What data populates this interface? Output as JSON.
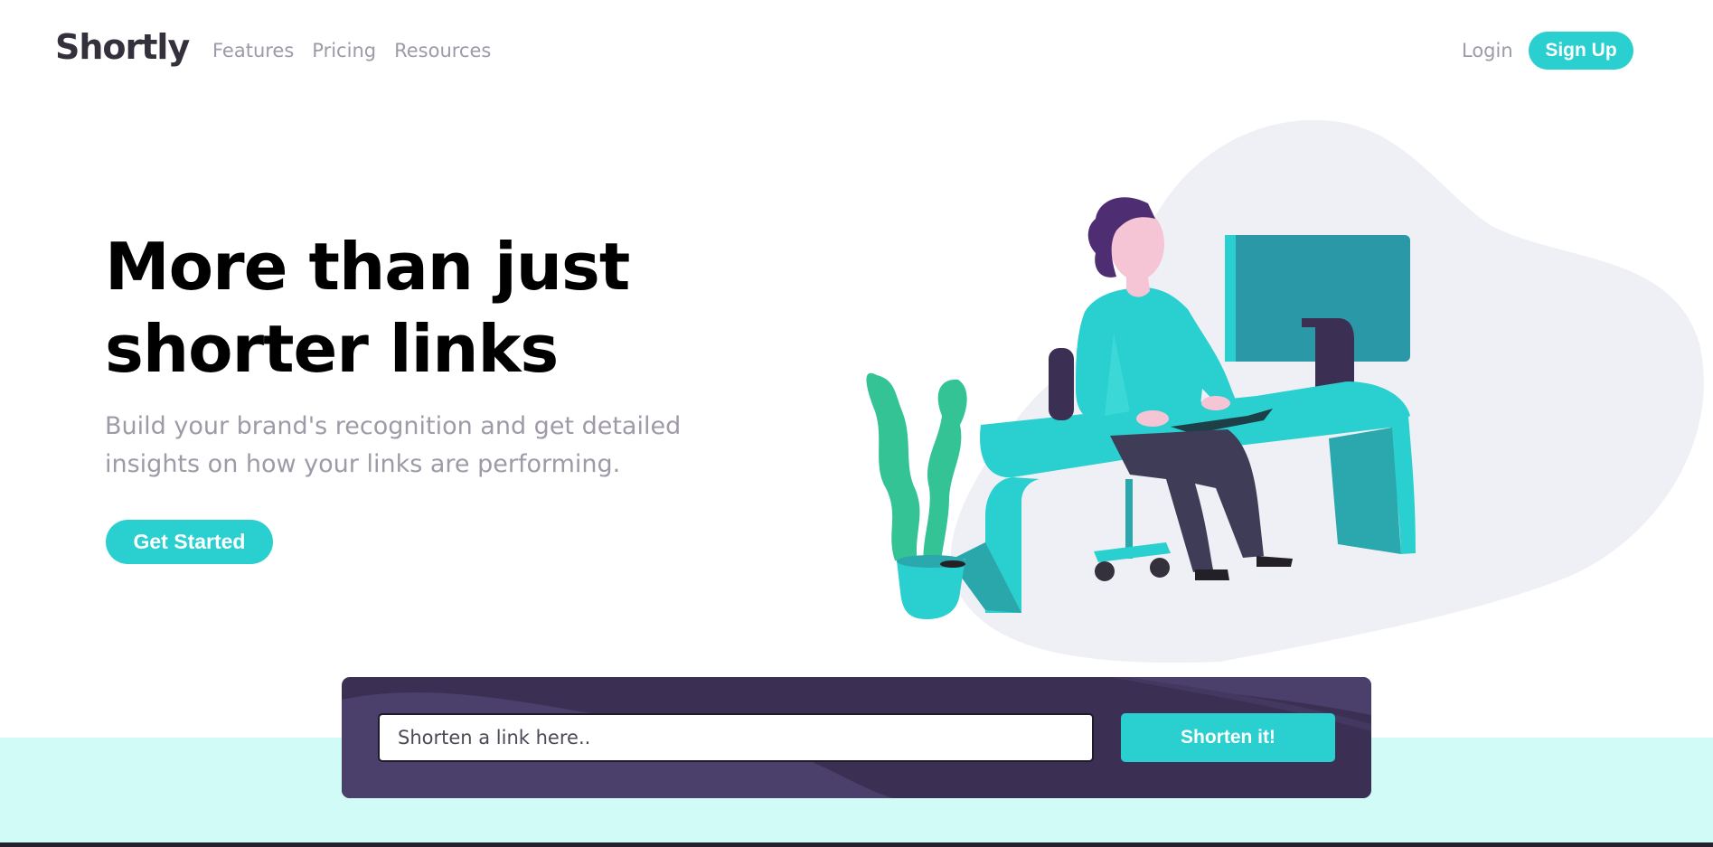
{
  "header": {
    "logo": "Shortly",
    "nav": [
      "Features",
      "Pricing",
      "Resources"
    ],
    "login": "Login",
    "signup": "Sign Up"
  },
  "hero": {
    "title": "More than just shorter links",
    "subtitle": "Build your brand's recognition and get detailed insights on how your links are performing.",
    "cta": "Get Started"
  },
  "shorten": {
    "placeholder": "Shorten a link here..",
    "button": "Shorten it!"
  },
  "colors": {
    "accent": "#2acfcf",
    "dark_violet": "#3b3054",
    "band": "#d0fbf7",
    "gray_text": "#9e9aa7"
  }
}
